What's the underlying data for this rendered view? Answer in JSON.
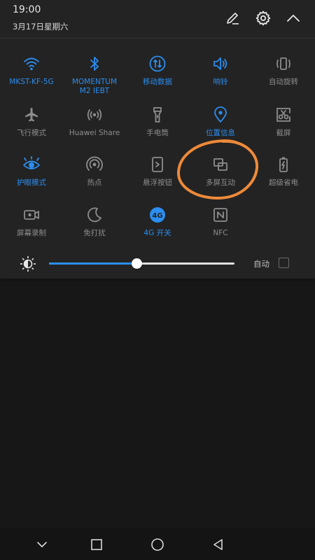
{
  "status": {
    "time": "19:00",
    "date": "3月17日星期六"
  },
  "colors": {
    "active": "#2b8ef0",
    "inactive": "#8d8d8d",
    "annotation": "#ee8a3a"
  },
  "tiles": [
    {
      "label": "MKST-KF-5G",
      "icon": "wifi-icon",
      "active": true
    },
    {
      "label": "MOMENTUM\nM2 IEBT",
      "icon": "bluetooth-icon",
      "active": true
    },
    {
      "label": "移动数据",
      "icon": "mobile-data-icon",
      "active": true
    },
    {
      "label": "响铃",
      "icon": "volume-icon",
      "active": true
    },
    {
      "label": "自动旋转",
      "icon": "auto-rotate-icon",
      "active": false
    },
    {
      "label": "飞行模式",
      "icon": "airplane-icon",
      "active": false
    },
    {
      "label": "Huawei Share",
      "icon": "huawei-share-icon",
      "active": false
    },
    {
      "label": "手电筒",
      "icon": "flashlight-icon",
      "active": false
    },
    {
      "label": "位置信息",
      "icon": "location-icon",
      "active": true
    },
    {
      "label": "截屏",
      "icon": "screenshot-icon",
      "active": false
    },
    {
      "label": "护眼模式",
      "icon": "eye-icon",
      "active": true
    },
    {
      "label": "热点",
      "icon": "hotspot-icon",
      "active": false
    },
    {
      "label": "悬浮按钮",
      "icon": "floating-button-icon",
      "active": false
    },
    {
      "label": "多屏互动",
      "icon": "multi-screen-icon",
      "active": false
    },
    {
      "label": "超级省电",
      "icon": "battery-saver-icon",
      "active": false
    },
    {
      "label": "屏幕录制",
      "icon": "screen-record-icon",
      "active": false
    },
    {
      "label": "免打扰",
      "icon": "moon-icon",
      "active": false
    },
    {
      "label": "4G 开关",
      "icon": "4g-icon",
      "active": true
    },
    {
      "label": "NFC",
      "icon": "nfc-icon",
      "active": false
    }
  ],
  "brightness": {
    "level": 0.47,
    "auto_label": "自动",
    "auto_checked": false
  },
  "icons": {
    "4g_text": "4G"
  }
}
